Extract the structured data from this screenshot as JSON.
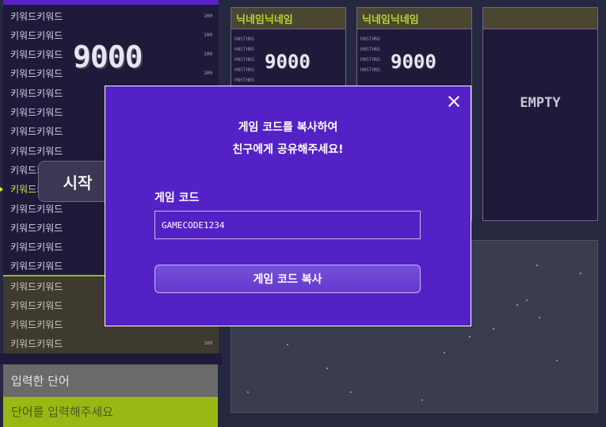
{
  "keywords": {
    "main_items": [
      {
        "text": "키워드키워드",
        "hp": "100"
      },
      {
        "text": "키워드키워드",
        "hp": "100"
      },
      {
        "text": "키워드키워드",
        "hp": "100"
      },
      {
        "text": "키워드키워드",
        "hp": "100"
      },
      {
        "text": "키워드키워드",
        "hp": ""
      },
      {
        "text": "키워드키워드",
        "hp": ""
      },
      {
        "text": "키워드키워드",
        "hp": ""
      },
      {
        "text": "키워드키워드",
        "hp": ""
      },
      {
        "text": "키워드키워드",
        "hp": ""
      },
      {
        "text": "키워드키워드",
        "hp": ""
      },
      {
        "text": "키워드키워드",
        "hp": ""
      },
      {
        "text": "키워드키워드",
        "hp": ""
      },
      {
        "text": "키워드키워드",
        "hp": ""
      },
      {
        "text": "키워드키워드",
        "hp": ""
      }
    ],
    "active_index": 9,
    "secondary_items": [
      {
        "text": "키워드키워드",
        "hp": ""
      },
      {
        "text": "키워드키워드",
        "hp": ""
      },
      {
        "text": "키워드키워드",
        "hp": ""
      },
      {
        "text": "키워드키워드",
        "hp": "100"
      }
    ]
  },
  "score_display": "9000",
  "start_button_label": "시작",
  "word_input": {
    "submitted_label": "입력한 단어",
    "placeholder": "단어를 입력해주세요"
  },
  "players": [
    {
      "name": "닉네임닉네임",
      "score": "9000",
      "lines": [
        "HNSTHNS",
        "HNSTHNS",
        "HNSTHNS",
        "HNSTHNS",
        "HNSTHNS"
      ]
    },
    {
      "name": "닉네임닉네임",
      "score": "9000",
      "lines": [
        "HNSTHNS",
        "HNSTHNS",
        "HNSTHNS",
        "HNSTHNS"
      ]
    },
    {
      "name": "",
      "empty_label": "EMPTY"
    }
  ],
  "modal": {
    "message_line1": "게임 코드를 복사하여",
    "message_line2": "친구에게 공유해주세요!",
    "code_label": "게임 코드",
    "code_value": "GAMECODE1234",
    "copy_button_label": "게임 코드 복사"
  },
  "colors": {
    "background": "#262840",
    "modal": "#5421c7",
    "accent_green": "#98b914",
    "nickname": "#b5d435"
  }
}
